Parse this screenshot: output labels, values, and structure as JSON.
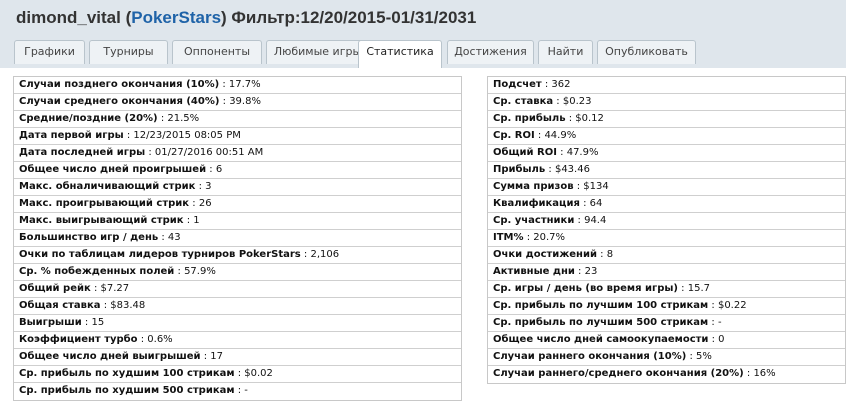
{
  "header": {
    "user": "dimond_vital",
    "open_paren": " (",
    "site": "PokerStars",
    "filter": ") Фильтр:12/20/2015-01/31/2031"
  },
  "tabs": [
    {
      "label": "Графики"
    },
    {
      "label": "Турниры"
    },
    {
      "label": "Оппоненты"
    },
    {
      "label": "Любимые игры"
    },
    {
      "label": "Статистика"
    },
    {
      "label": "Достижения"
    },
    {
      "label": "Найти"
    },
    {
      "label": "Опубликовать"
    }
  ],
  "active_tab": "Статистика",
  "left_stats": [
    {
      "label": "Случаи позднего окончания (10%)",
      "value": "17.7%"
    },
    {
      "label": "Случаи среднего окончания (40%)",
      "value": "39.8%"
    },
    {
      "label": "Средние/поздние (20%)",
      "value": "21.5%"
    },
    {
      "label": "Дата первой игры",
      "value": "12/23/2015 08:05 PM"
    },
    {
      "label": "Дата последней игры",
      "value": "01/27/2016 00:51 AM"
    },
    {
      "label": "Общее число дней проигрышей",
      "value": "6"
    },
    {
      "label": "Макс. обналичивающий стрик",
      "value": "3"
    },
    {
      "label": "Макс. проигрывающий стрик",
      "value": "26"
    },
    {
      "label": "Макс. выигрывающий стрик",
      "value": "1"
    },
    {
      "label": "Большинство игр / день",
      "value": "43"
    },
    {
      "label": "Очки по таблицам лидеров турниров PokerStars",
      "value": "2,106"
    },
    {
      "label": "Ср. % побежденных полей",
      "value": "57.9%"
    },
    {
      "label": "Общий рейк",
      "value": "$7.27"
    },
    {
      "label": "Общая ставка",
      "value": "$83.48"
    },
    {
      "label": "Выигрыши",
      "value": "15"
    },
    {
      "label": "Коэффициент турбо",
      "value": "0.6%"
    },
    {
      "label": "Общее число дней выигрышей",
      "value": "17"
    },
    {
      "label": "Ср. прибыль по худшим 100 стрикам",
      "value": "$0.02"
    },
    {
      "label": "Ср. прибыль по худшим 500 стрикам",
      "value": "-"
    }
  ],
  "right_stats": [
    {
      "label": "Подсчет",
      "value": "362"
    },
    {
      "label": "Ср. ставка",
      "value": "$0.23"
    },
    {
      "label": "Ср. прибыль",
      "value": "$0.12"
    },
    {
      "label": "Ср. ROI",
      "value": "44.9%"
    },
    {
      "label": "Общий ROI",
      "value": "47.9%"
    },
    {
      "label": "Прибыль",
      "value": "$43.46"
    },
    {
      "label": "Сумма призов",
      "value": "$134"
    },
    {
      "label": "Квалификация",
      "value": "64"
    },
    {
      "label": "Ср. участники",
      "value": "94.4"
    },
    {
      "label": "ITM%",
      "value": "20.7%"
    },
    {
      "label": "Очки достижений",
      "value": "8"
    },
    {
      "label": "Активные дни",
      "value": "23"
    },
    {
      "label": "Ср. игры / день (во время игры)",
      "value": "15.7"
    },
    {
      "label": "Ср. прибыль по лучшим 100 стрикам",
      "value": "$0.22"
    },
    {
      "label": "Ср. прибыль по лучшим 500 стрикам",
      "value": "-"
    },
    {
      "label": "Общее число дней самоокупаемости",
      "value": "0"
    },
    {
      "label": "Случаи раннего окончания (10%)",
      "value": "5%"
    },
    {
      "label": "Случаи раннего/среднего окончания (20%)",
      "value": "16%"
    }
  ],
  "separator": " : "
}
